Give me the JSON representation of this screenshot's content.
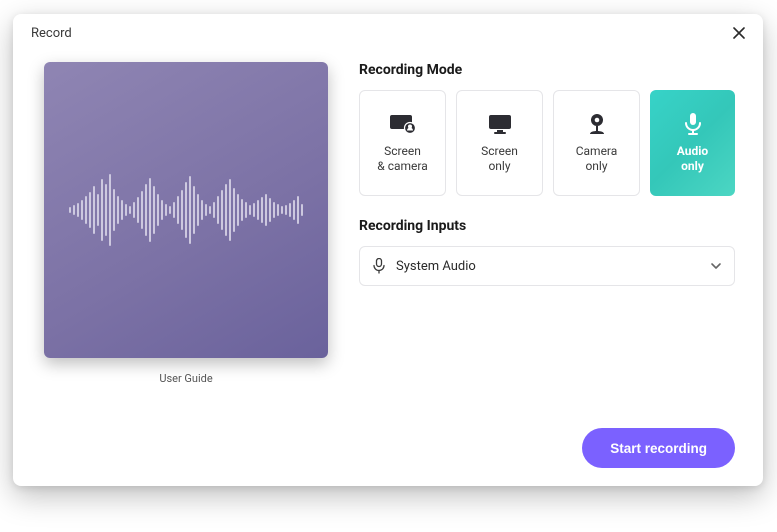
{
  "window": {
    "title": "Record"
  },
  "preview": {
    "caption": "User Guide"
  },
  "sections": {
    "mode_title": "Recording Mode",
    "inputs_title": "Recording Inputs"
  },
  "modes": [
    {
      "id": "screen-camera",
      "icon": "screen-camera-icon",
      "label": "Screen\n& camera",
      "selected": false
    },
    {
      "id": "screen-only",
      "icon": "screen-icon",
      "label": "Screen\nonly",
      "selected": false
    },
    {
      "id": "camera-only",
      "icon": "camera-icon",
      "label": "Camera\nonly",
      "selected": false
    },
    {
      "id": "audio-only",
      "icon": "mic-icon",
      "label": "Audio\nonly",
      "selected": true
    }
  ],
  "input_select": {
    "icon": "mic-icon",
    "value": "System Audio"
  },
  "actions": {
    "start_label": "Start recording"
  },
  "colors": {
    "accent_primary": "#7b61ff",
    "accent_teal_from": "#37d3c8",
    "accent_teal_to": "#4cd6c3",
    "preview_from": "#8f85b3",
    "preview_to": "#6a629c"
  }
}
